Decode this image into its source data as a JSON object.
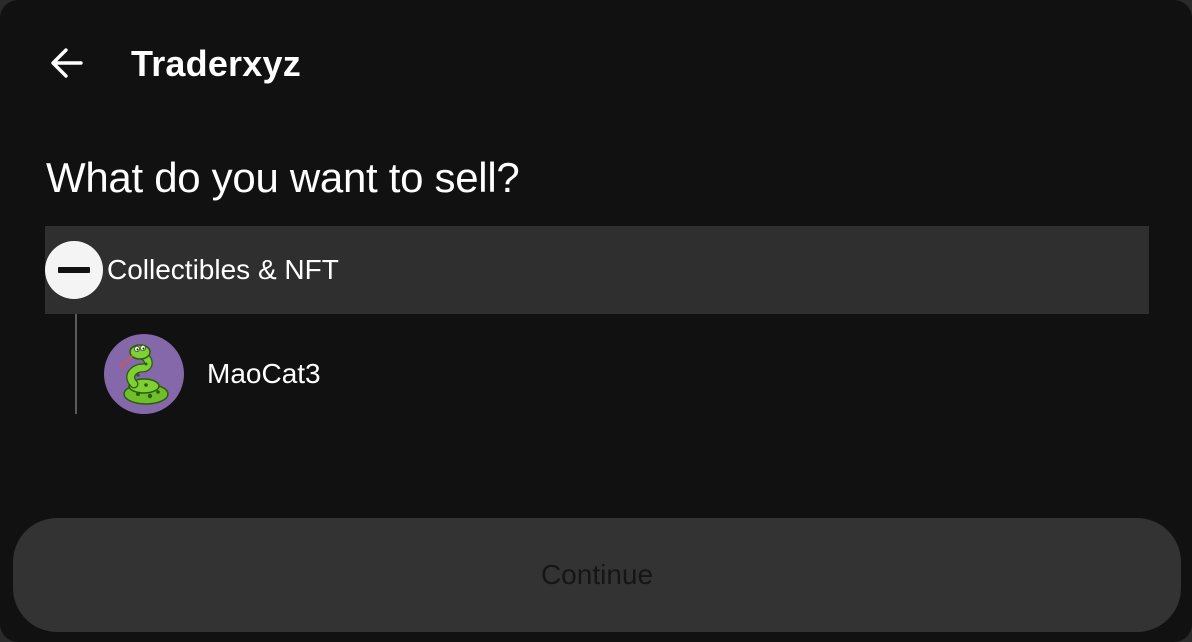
{
  "header": {
    "back_icon": "arrow-left-icon",
    "title": "Traderxyz"
  },
  "main": {
    "question": "What do you want to sell?",
    "category": {
      "label": "Collectibles & NFT",
      "toggle_icon": "minus-circle-icon",
      "expanded": true
    },
    "items": [
      {
        "name": "MaoCat3",
        "avatar_icon": "green-snake-avatar",
        "avatar_bg": "#8468a9"
      }
    ]
  },
  "footer": {
    "continue_label": "Continue",
    "enabled": false
  },
  "colors": {
    "background": "#111111",
    "row_highlight": "#2f2f2f",
    "button_disabled": "#333333",
    "text": "#ffffff"
  }
}
